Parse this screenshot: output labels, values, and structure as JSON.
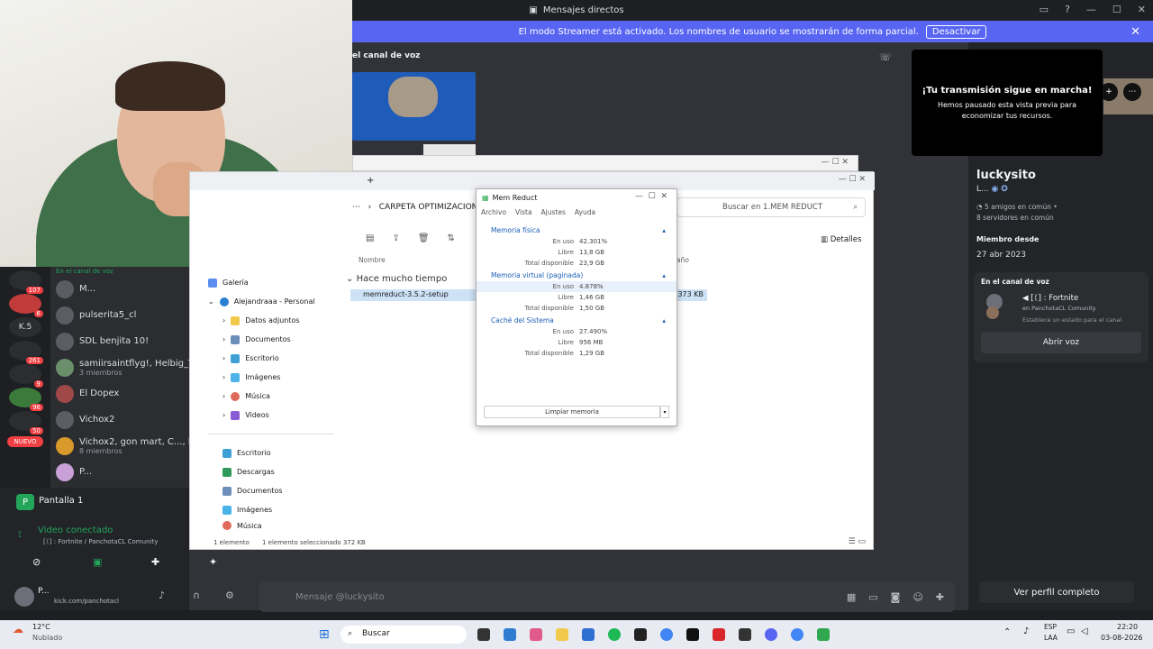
{
  "window": {
    "title": "Mensajes directos"
  },
  "streamer_banner": {
    "text": "El modo Streamer está activado. Los nombres de usuario se mostrarán de forma parcial.",
    "button": "Desactivar"
  },
  "voice_channel_header": "el canal de voz",
  "stream_paused": {
    "title": "¡Tu transmisión sigue en marcha!",
    "text": "Hemos pausado esta vista previa para economizar tus recursos."
  },
  "servers": [
    {
      "label": "",
      "badge": "107"
    },
    {
      "label": "",
      "badge": "6"
    },
    {
      "label": "K.5",
      "badge": ""
    },
    {
      "label": "",
      "badge": "261"
    },
    {
      "label": "",
      "badge": "9"
    },
    {
      "label": "",
      "badge": "96"
    },
    {
      "label": "",
      "badge": "50"
    },
    {
      "label": "NUEVO",
      "badge": ""
    }
  ],
  "dms": [
    {
      "name": "En el canal de voz",
      "sub": ""
    },
    {
      "name": "M...",
      "sub": ""
    },
    {
      "name": "pulserita5_cl",
      "sub": ""
    },
    {
      "name": "SDL benjita 10!",
      "sub": ""
    },
    {
      "name": "samiirsaintflyg!, Helbig_Tl",
      "sub": "3 miembros"
    },
    {
      "name": "El Dopex",
      "sub": ""
    },
    {
      "name": "Vichox2",
      "sub": ""
    },
    {
      "name": "Vichox2, gon mart, C..., D",
      "sub": "8 miembros"
    },
    {
      "name": "P...",
      "sub": ""
    }
  ],
  "screen_share": {
    "label": "Pantalla 1"
  },
  "video": {
    "status": "Video conectado",
    "detail": "[ᛕ] : Fortnite / PanchotaCL Comunity"
  },
  "user": {
    "name": "P...",
    "status": "kick.com/panchotacl"
  },
  "explorer": {
    "tab_label": "CARPETA OPTIMIZACION",
    "search_placeholder": "Buscar en 1.MEM REDUCT",
    "details_label": "Detalles",
    "col_name": "Nombre",
    "col_size": "año",
    "group_label": "Hace mucho tiempo",
    "file": {
      "name": "memreduct-3.5.2-setup",
      "size": "373 KB"
    },
    "status": {
      "count": "1 elemento",
      "selected": "1 elemento seleccionado  372 KB"
    },
    "nav": [
      {
        "label": "Galería"
      },
      {
        "label": "Alejandraaa - Personal"
      },
      {
        "label": "Datos adjuntos"
      },
      {
        "label": "Documentos"
      },
      {
        "label": "Escritorio"
      },
      {
        "label": "Imágenes"
      },
      {
        "label": "Música"
      },
      {
        "label": "Videos"
      }
    ],
    "quick": [
      {
        "label": "Escritorio"
      },
      {
        "label": "Descargas"
      },
      {
        "label": "Documentos"
      },
      {
        "label": "Imágenes"
      },
      {
        "label": "Música"
      }
    ]
  },
  "memreduct": {
    "title": "Mem Reduct",
    "menu": [
      "Archivo",
      "Vista",
      "Ajustes",
      "Ayuda"
    ],
    "sections": [
      {
        "title": "Memoria física",
        "rows": [
          {
            "k": "En uso",
            "v": "42.301%"
          },
          {
            "k": "Libre",
            "v": "13,8 GB"
          },
          {
            "k": "Total disponible",
            "v": "23,9 GB"
          }
        ]
      },
      {
        "title": "Memoria virtual (paginada)",
        "rows": [
          {
            "k": "En uso",
            "v": "4.878%"
          },
          {
            "k": "Libre",
            "v": "1,46 GB"
          },
          {
            "k": "Total disponible",
            "v": "1,50 GB"
          }
        ]
      },
      {
        "title": "Caché del Sistema",
        "rows": [
          {
            "k": "En uso",
            "v": "27.490%"
          },
          {
            "k": "Libre",
            "v": "956 MB"
          },
          {
            "k": "Total disponible",
            "v": "1,29 GB"
          }
        ]
      }
    ],
    "clean_button": "Limpiar memoria"
  },
  "profile": {
    "name": "luckysito",
    "tag": "L...",
    "friends": "5 amigos en común",
    "servers": "8 servidores en común",
    "member_since_label": "Miembro desde",
    "member_since": "27 abr 2023",
    "voice_label": "En el canal de voz",
    "voice_title": "[ᛕ] : Fortnite",
    "voice_server": "en PanchotaCL Comunity",
    "voice_status": "Establece un estado para el canal",
    "open_voice": "Abrir voz",
    "full_profile": "Ver perfil completo"
  },
  "composer": {
    "placeholder": "Mensaje @luckysito"
  },
  "taskbar": {
    "weather_temp": "12°C",
    "weather_desc": "Nublado",
    "search": "Buscar",
    "lang": "ESP",
    "lang2": "LAA",
    "time": "22:20",
    "date": "03-08-2026"
  }
}
